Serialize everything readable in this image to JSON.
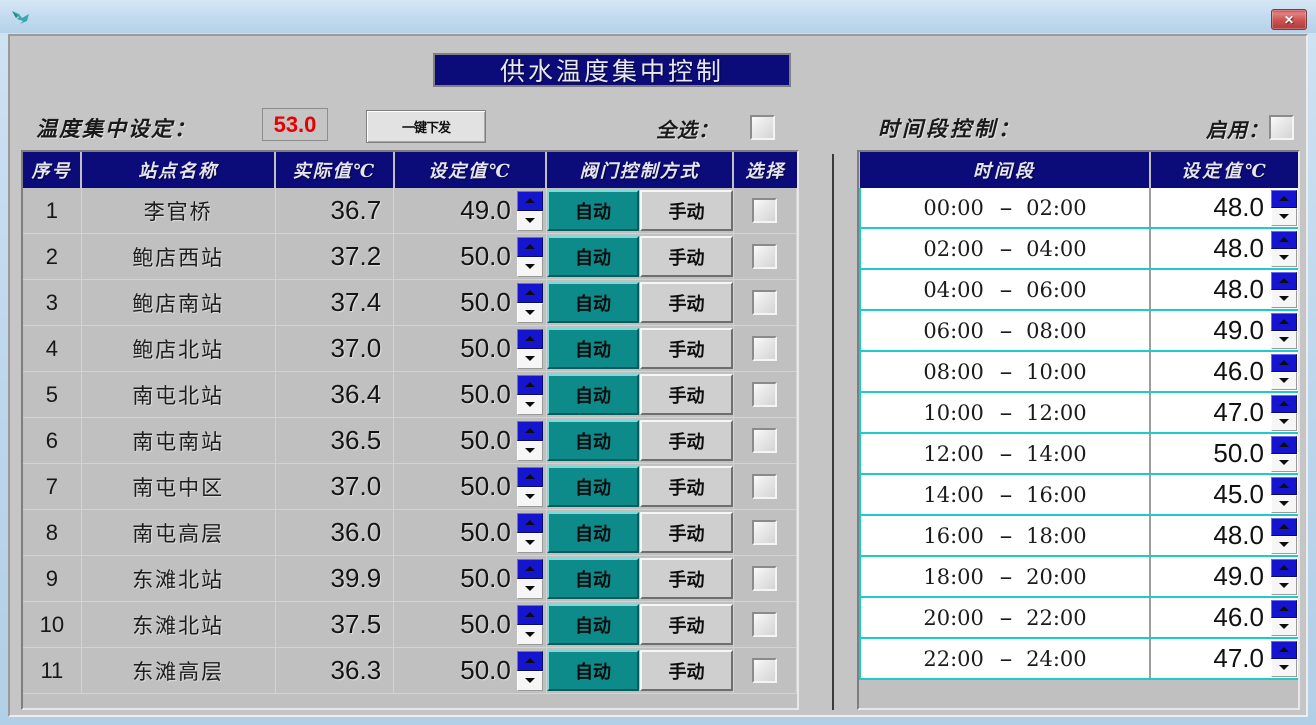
{
  "window": {
    "app_icon": "bird-logo-icon",
    "close_label": "✕",
    "close_icon": "close-icon"
  },
  "banner": {
    "title": "供水温度集中控制"
  },
  "toolbar": {
    "central_set_label": "温度集中设定：",
    "central_set_value": "53.0",
    "central_set_color": "#e60000",
    "send_all_label": "一键下发",
    "select_all_label": "全选：",
    "select_all_checked": false,
    "time_control_label": "时间段控制：",
    "enable_label": "启用：",
    "enable_checked": false
  },
  "station_table": {
    "columns": [
      "序号",
      "站点名称",
      "实际值℃",
      "设定值℃",
      "阀门控制方式",
      "选择"
    ],
    "mode_auto_label": "自动",
    "mode_manual_label": "手动",
    "rows": [
      {
        "idx": "1",
        "name": "李官桥",
        "actual": "36.7",
        "set": "49.0",
        "mode": "auto",
        "selected": false
      },
      {
        "idx": "2",
        "name": "鲍店西站",
        "actual": "37.2",
        "set": "50.0",
        "mode": "auto",
        "selected": false
      },
      {
        "idx": "3",
        "name": "鲍店南站",
        "actual": "37.4",
        "set": "50.0",
        "mode": "auto",
        "selected": false
      },
      {
        "idx": "4",
        "name": "鲍店北站",
        "actual": "37.0",
        "set": "50.0",
        "mode": "auto",
        "selected": false
      },
      {
        "idx": "5",
        "name": "南屯北站",
        "actual": "36.4",
        "set": "50.0",
        "mode": "auto",
        "selected": false
      },
      {
        "idx": "6",
        "name": "南屯南站",
        "actual": "36.5",
        "set": "50.0",
        "mode": "auto",
        "selected": false
      },
      {
        "idx": "7",
        "name": "南屯中区",
        "actual": "37.0",
        "set": "50.0",
        "mode": "auto",
        "selected": false
      },
      {
        "idx": "8",
        "name": "南屯高层",
        "actual": "36.0",
        "set": "50.0",
        "mode": "auto",
        "selected": false
      },
      {
        "idx": "9",
        "name": "东滩北站",
        "actual": "39.9",
        "set": "50.0",
        "mode": "auto",
        "selected": false
      },
      {
        "idx": "10",
        "name": "东滩北站",
        "actual": "37.5",
        "set": "50.0",
        "mode": "auto",
        "selected": false
      },
      {
        "idx": "11",
        "name": "东滩高层",
        "actual": "36.3",
        "set": "50.0",
        "mode": "auto",
        "selected": false
      }
    ]
  },
  "schedule_table": {
    "columns": [
      "时间段",
      "设定值℃"
    ],
    "separator": "--",
    "rows": [
      {
        "start": "00:00",
        "end": "02:00",
        "set": "48.0"
      },
      {
        "start": "02:00",
        "end": "04:00",
        "set": "48.0"
      },
      {
        "start": "04:00",
        "end": "06:00",
        "set": "48.0"
      },
      {
        "start": "06:00",
        "end": "08:00",
        "set": "49.0"
      },
      {
        "start": "08:00",
        "end": "10:00",
        "set": "46.0"
      },
      {
        "start": "10:00",
        "end": "12:00",
        "set": "47.0"
      },
      {
        "start": "12:00",
        "end": "14:00",
        "set": "50.0"
      },
      {
        "start": "14:00",
        "end": "16:00",
        "set": "45.0"
      },
      {
        "start": "16:00",
        "end": "18:00",
        "set": "48.0"
      },
      {
        "start": "18:00",
        "end": "20:00",
        "set": "49.0"
      },
      {
        "start": "20:00",
        "end": "22:00",
        "set": "46.0"
      },
      {
        "start": "22:00",
        "end": "24:00",
        "set": "47.0"
      }
    ]
  },
  "colors": {
    "header_blue": "#0b0b7a",
    "auto_teal": "#0d8a8a",
    "grid_cyan": "#1ecbcb",
    "spinner_blue": "#1515cf",
    "window_gray": "#c0c0c0"
  }
}
